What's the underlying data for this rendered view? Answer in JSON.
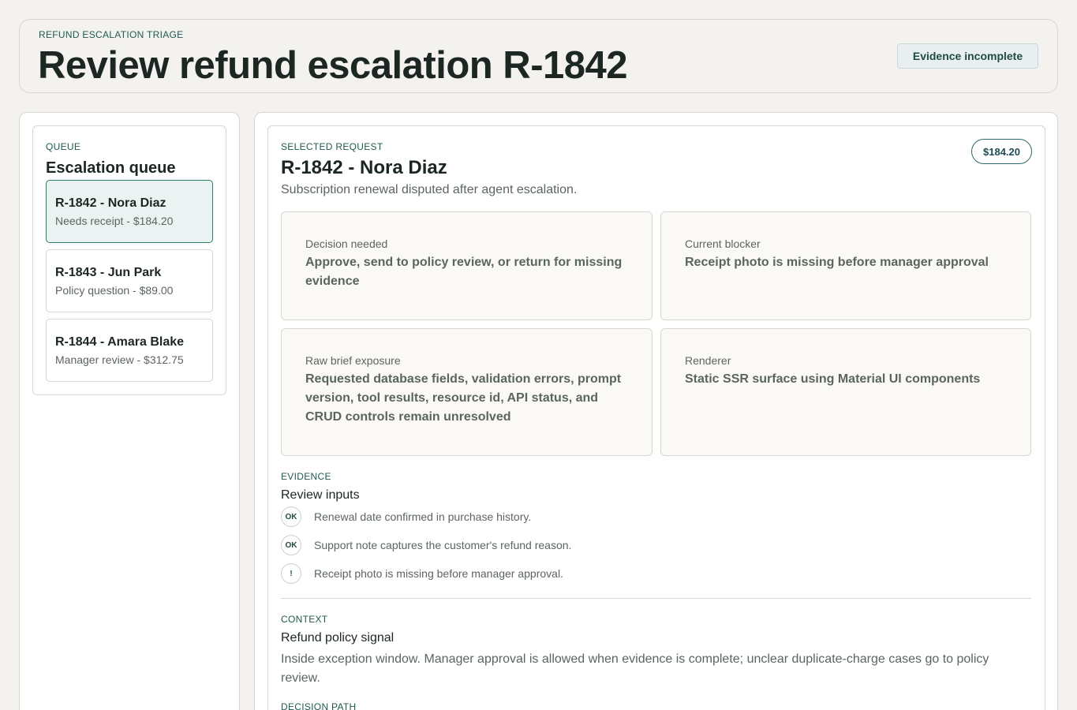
{
  "header": {
    "eyebrow": "REFUND ESCALATION TRIAGE",
    "title": "Review refund escalation R-1842",
    "status_chip": "Evidence incomplete"
  },
  "queue": {
    "eyebrow": "QUEUE",
    "title": "Escalation queue",
    "items": [
      {
        "title": "R-1842 - Nora Diaz",
        "subtitle": "Needs receipt - $184.20",
        "selected": true
      },
      {
        "title": "R-1843 - Jun Park",
        "subtitle": "Policy question - $89.00",
        "selected": false
      },
      {
        "title": "R-1844 - Amara Blake",
        "subtitle": "Manager review - $312.75",
        "selected": false
      }
    ]
  },
  "detail": {
    "eyebrow": "SELECTED REQUEST",
    "title": "R-1842 - Nora Diaz",
    "subtitle": "Subscription renewal disputed after agent escalation.",
    "amount": "$184.20",
    "boxes": [
      {
        "label": "Decision needed",
        "value": "Approve, send to policy review, or return for missing evidence"
      },
      {
        "label": "Current blocker",
        "value": "Receipt photo is missing before manager approval"
      },
      {
        "label": "Raw brief exposure",
        "value": "Requested database fields, validation errors, prompt version, tool results, resource id, API status, and CRUD controls remain unresolved"
      },
      {
        "label": "Renderer",
        "value": "Static SSR surface using Material UI components"
      }
    ],
    "evidence": {
      "eyebrow": "EVIDENCE",
      "title": "Review inputs",
      "items": [
        {
          "badge": "OK",
          "text": "Renewal date confirmed in purchase history."
        },
        {
          "badge": "OK",
          "text": "Support note captures the customer's refund reason."
        },
        {
          "badge": "!",
          "text": "Receipt photo is missing before manager approval."
        }
      ]
    },
    "context": {
      "eyebrow": "CONTEXT",
      "title": "Refund policy signal",
      "text": "Inside exception window. Manager approval is allowed when evidence is complete; unclear duplicate-charge cases go to policy review."
    },
    "decision_path": {
      "eyebrow": "DECISION PATH"
    }
  }
}
